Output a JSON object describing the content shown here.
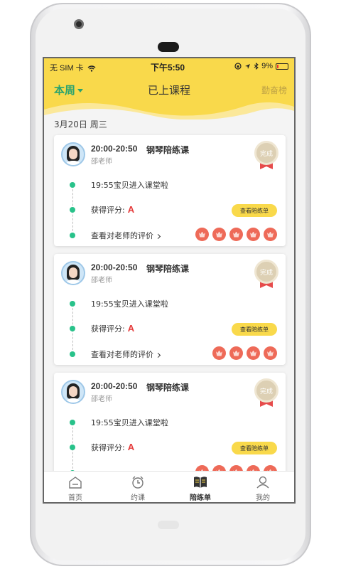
{
  "status_bar": {
    "carrier": "无 SIM 卡",
    "time": "下午5:50",
    "battery": "9%"
  },
  "header": {
    "week_filter": "本周",
    "title": "已上课程",
    "leaderboard": "勤奋榜"
  },
  "date_heading": "3月20日  周三",
  "colors": {
    "brand_yellow": "#f9d94b",
    "accent_green": "#28c28a",
    "medal_red": "#ee6a58"
  },
  "courses": [
    {
      "time": "20:00-20:50",
      "name": "钢琴陪练课",
      "teacher": "邵老师",
      "seal": "完成",
      "entered": "19:55宝贝进入课堂啦",
      "score_label": "获得评分:",
      "grade": "A",
      "sheet_button": "查看陪练单",
      "review_link": "查看对老师的评价",
      "medal_count": 5
    },
    {
      "time": "20:00-20:50",
      "name": "钢琴陪练课",
      "teacher": "邵老师",
      "seal": "完成",
      "entered": "19:55宝贝进入课堂啦",
      "score_label": "获得评分:",
      "grade": "A",
      "sheet_button": "查看陪练单",
      "review_link": "查看对老师的评价",
      "medal_count": 4
    },
    {
      "time": "20:00-20:50",
      "name": "钢琴陪练课",
      "teacher": "邵老师",
      "seal": "完成",
      "entered": "19:55宝贝进入课堂啦",
      "score_label": "获得评分:",
      "grade": "A",
      "sheet_button": "查看陪练单",
      "review_link": "",
      "medal_count": 5
    }
  ],
  "tabs": [
    {
      "label": "首页",
      "icon": "home-icon"
    },
    {
      "label": "约课",
      "icon": "alarm-clock-icon"
    },
    {
      "label": "陪练单",
      "icon": "book-icon",
      "active": true
    },
    {
      "label": "我的",
      "icon": "person-icon"
    }
  ]
}
